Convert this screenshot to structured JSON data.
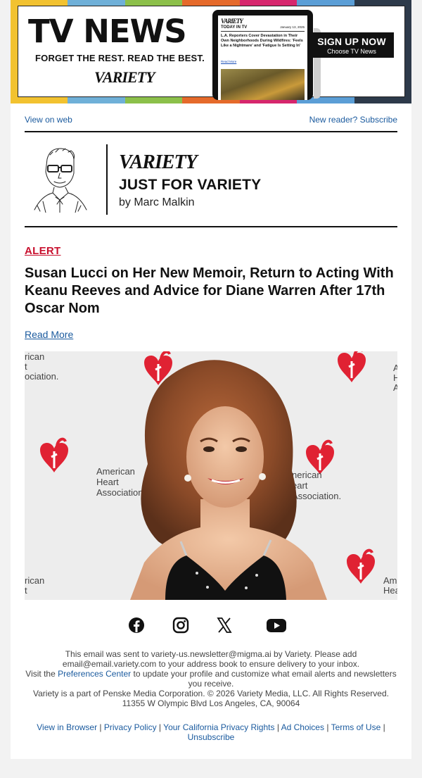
{
  "banner": {
    "title": "TV NEWS",
    "tagline": "FORGET THE REST. READ THE BEST.",
    "logo": "VARIETY",
    "signup_main": "SIGN UP NOW",
    "signup_sub": "Choose TV News",
    "tablet": {
      "logo": "VARIETY",
      "section": "TODAY IN TV",
      "date": "January 13, 2025",
      "story": "L.A. Reporters Cover Devastation in Their Own Neighborhoods During Wildfires: 'Feels Like a Nightmare' and 'Fatigue Is Setting In'",
      "read_more": "Read More"
    },
    "stripe_colors": [
      "#f2c230",
      "#6fb0d8",
      "#8cc04a",
      "#e56a2b",
      "#d6266d",
      "#5b9ed6",
      "#2d3a4a"
    ]
  },
  "top_links": {
    "view_web": "View on web",
    "subscribe": "New reader? Subscribe"
  },
  "column": {
    "logo": "VARIETY",
    "title": "JUST FOR VARIETY",
    "byline": "by Marc Malkin"
  },
  "article": {
    "label": "ALERT",
    "headline": "Susan Lucci on Her New Memoir, Return to Acting With Keanu Reeves and Advice for Diane Warren After 17th Oscar Nom",
    "read_more": "Read More",
    "backdrop_text": "American Heart Association"
  },
  "social": [
    "facebook-icon",
    "instagram-icon",
    "x-icon",
    "youtube-icon"
  ],
  "footer": {
    "line1": "This email was sent to variety-us.newsletter@migma.ai by Variety. Please add email@email.variety.com to your address book to ensure delivery to your inbox.",
    "visit_pre": "Visit the ",
    "preferences": "Preferences Center",
    "visit_post": " to update your profile and customize what email alerts and newsletters you receive.",
    "copyright": "Variety is a part of Penske Media Corporation. © 2026 Variety Media, LLC. All Rights Reserved.",
    "address": "11355 W Olympic Blvd Los Angeles, CA, 90064",
    "links": [
      "View in Browser",
      "Privacy Policy",
      "Your California Privacy Rights",
      "Ad Choices",
      "Terms of Use",
      "Unsubscribe"
    ],
    "separator": "|"
  },
  "colors": {
    "link": "#1a5a9e",
    "alert": "#c8102e",
    "text": "#111111"
  }
}
